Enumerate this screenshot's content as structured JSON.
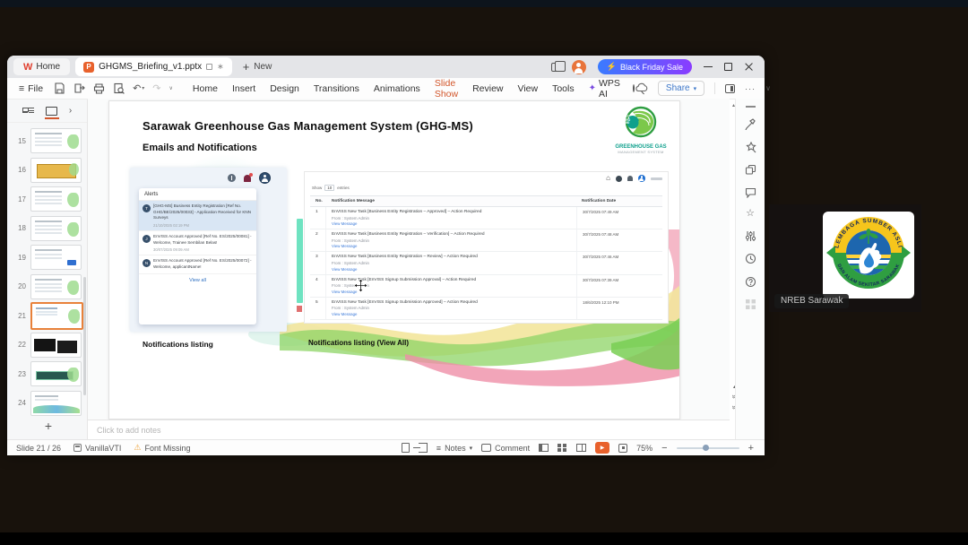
{
  "icons": {
    "hamburger": "≡",
    "plus": "+",
    "minus": "−",
    "chevron_down": "▾",
    "chevron_up": "▴",
    "chevron_right": "›",
    "chevron_small": "∨",
    "double_chevron": "»",
    "ellipsis": "···",
    "undo": "↶",
    "redo": "↷",
    "asterisk": "∗",
    "sparkle": "✦",
    "lightning": "⚡",
    "warning": "⚠",
    "play": "▶",
    "home": "⌂",
    "w_logo": "W",
    "p_logo": "P"
  },
  "titlebar": {
    "home_tab": "Home",
    "doc_tab": "GHGMS_Briefing_v1.pptx",
    "new_label": "New",
    "promo": "Black Friday Sale"
  },
  "toolbar": {
    "file_label": "File",
    "menus": [
      {
        "label": "Home"
      },
      {
        "label": "Insert"
      },
      {
        "label": "Design"
      },
      {
        "label": "Transitions"
      },
      {
        "label": "Animations"
      },
      {
        "label": "Slide Show",
        "cls": "active"
      },
      {
        "label": "Review"
      },
      {
        "label": "View"
      },
      {
        "label": "Tools"
      }
    ],
    "wps_ai": "WPS AI",
    "share_label": "Share"
  },
  "slide_panel": {
    "slides": [
      {
        "num": "15",
        "cls": "v15"
      },
      {
        "num": "16",
        "cls": "v16"
      },
      {
        "num": "17",
        "cls": "v17"
      },
      {
        "num": "18",
        "cls": "v18"
      },
      {
        "num": "19",
        "cls": "v19"
      },
      {
        "num": "20",
        "cls": "v20"
      },
      {
        "num": "21",
        "cls": "v21 selected"
      },
      {
        "num": "22",
        "cls": "v22"
      },
      {
        "num": "23",
        "cls": "v23"
      },
      {
        "num": "24",
        "cls": "v24"
      }
    ]
  },
  "slide": {
    "title": "Sarawak Greenhouse Gas Management System (GHG-MS)",
    "subtitle": "Emails and Notifications",
    "logo": {
      "badge": "NET ZERO 2050",
      "line1": "GREENHOUSE GAS",
      "line2": "MANAGEMENT SYSTEM"
    },
    "alerts": {
      "header": "Alerts",
      "view_all": "View all",
      "items": [
        {
          "initial": "T",
          "cls": "hl",
          "text": "[GHG-MS] Business Entity Registration [Ref No. GHG/BE/2025/00033] - Application Received for KNN Surveys",
          "date": "21/10/2025 02:19 PM"
        },
        {
          "initial": "J",
          "text": "EnVISS Account Approved [Ref No. ES/2025/00081] - Welcome, Trainee Sembilan Belas!",
          "date": "30/07/2025 09:09 AM"
        },
        {
          "initial": "N",
          "text": "EnVISS Account Approved [Ref No. ES/2025/00072] - Welcome, applicantName!"
        }
      ]
    },
    "table": {
      "show_label": "Show",
      "show_value": "10",
      "entries_label": "entries",
      "col_no": "No.",
      "col_msg": "Notification Message",
      "col_date": "Notification Date",
      "rows": [
        {
          "no": "1",
          "message": "EnVISS New Task [Business Entity Registration – Approved] – Action Required",
          "from": "From : System Admin",
          "link": "View Message",
          "date": "30/7/2025 07:49 AM"
        },
        {
          "no": "2",
          "message": "EnVISS New Task [Business Entity Registration – Verification] – Action Required",
          "from": "From : System Admin",
          "link": "View Message",
          "date": "30/7/2025 07:48 AM"
        },
        {
          "no": "3",
          "message": "EnVISS New Task [Business Entity Registration – Review] – Action Required",
          "from": "From : System Admin",
          "link": "View Message",
          "date": "30/7/2025 07:46 AM"
        },
        {
          "no": "4",
          "message": "EnVISS New Task [EnVISS Signup Submission Approval] – Action Required",
          "from": "From : System Admin",
          "link": "View Message",
          "date": "30/7/2025 07:39 AM"
        },
        {
          "no": "5",
          "message": "EnVISS New Task [EnVISS Signup Submission Approved] – Action Required",
          "from": "From : System Admin",
          "link": "View Message",
          "date": "18/6/2025 12:10 PM"
        }
      ]
    },
    "caption_left": "Notifications listing",
    "caption_right": "Notifications listing (View All)"
  },
  "notes_placeholder": "Click to add notes",
  "statusbar": {
    "slide_info": "Slide 21 / 26",
    "theme": "VanillaVTI",
    "font_missing": "Font Missing",
    "notes": "Notes",
    "comment": "Comment",
    "zoom": "75%"
  },
  "meeting": {
    "participant": "NREB Sarawak",
    "logo_top": "LEMBAGA SUMBER ASLI",
    "logo_bottom": "DAN ALAM SEKITAR SARAWAK"
  },
  "colors": {
    "accent": "#d2572c",
    "promo_from": "#3a7bff",
    "promo_to": "#8a3cff",
    "teal": "#0ea08c",
    "link": "#3b7ad9",
    "selection": "#e8813a",
    "highlight": "#d9e6f4"
  }
}
